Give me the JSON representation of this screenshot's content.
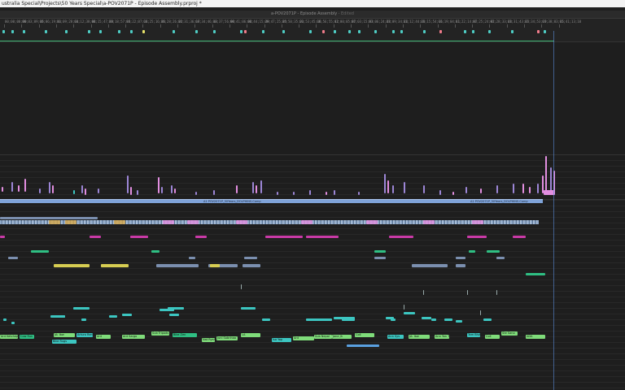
{
  "window": {
    "title": "ustralia Special\\Projects\\50 Years Special\\a-POV2071P - Episode Assembly.prproj *"
  },
  "panel": {
    "tab_label": "a-POV2071P - Episode Assembly",
    "tab_separator": "·",
    "tab_status": "Edited"
  },
  "ruler": {
    "timecodes": [
      "00;00;00;00",
      "00;03;09;15",
      "00;06;19;11",
      "00;09;28;11",
      "00;12;38;04",
      "00;15;47;20",
      "00;18;57;15",
      "00;22;07;11",
      "00;25;16;26",
      "00;28;26;22",
      "00;31;36;17",
      "00;34;46;13",
      "00;37;56;08",
      "00;41;06;04",
      "00;44;15;29",
      "00;47;25;25",
      "00;50;35;21",
      "00;53;45;16",
      "00;56;55;12",
      "01;00;05;07",
      "01;03;15;03",
      "01;06;24;28",
      "01;09;34;24",
      "01;12;44;20",
      "01;15;54;16",
      "01;19;04;11",
      "01;22;14;07",
      "01;25;24;02",
      "01;28;33;28",
      "01;31;43;23",
      "01;34;53;19",
      "01;38;03;15",
      "01;41;13;10"
    ],
    "marker_colors": [
      "#4ecdc4",
      "#4ecdc4",
      "#4ecdc4",
      "#4ecdc4",
      "#4ecdc4",
      "#4ecdc4",
      "#4ecdc4",
      "#4ecdc4",
      "#4ecdc4",
      "#e8e36a",
      "#4ecdc4",
      "#4ecdc4",
      "#4ecdc4",
      "#4ecdc4",
      "#ef7b8a",
      "#4ecdc4",
      "#4ecdc4",
      "#4ecdc4",
      "#ef7b8a",
      "#4ecdc4",
      "#4ecdc4",
      "#4ecdc4",
      "#4ecdc4",
      "#4ecdc4",
      "#4ecdc4",
      "#4ecdc4",
      "#ef7b8a",
      "#4ecdc4",
      "#4ecdc4",
      "#4ecdc4",
      "#4ecdc4",
      "#ef7b8a",
      "#4ecdc4"
    ]
  },
  "timeline": {
    "audio_clip_label_1": "A1  POV2071P_50Years_DOLPHINS-Comp",
    "audio_clip_label_2": "A1  POV2071P_50Years_DOLPHINS-Comp",
    "graphics_clip_labels": [
      "Ant Ketchep",
      "Cow Run",
      "JA: Ibw",
      "Arturo Rennels",
      "Ant",
      "Ant Sargo",
      "Sub Tripods",
      "Bike Zen",
      "Nat Ryan",
      "Juni Sabrinaa",
      "LA",
      "Isa Yap",
      "Ant",
      "Sub Nepal",
      "Jane Jh",
      "Coll",
      "Ann Sys",
      "JA: Ibw",
      "Ann Yan Tan",
      "Tam Bhwa",
      "Coll",
      "Ste Sano",
      "ADA",
      "Bike Rugs"
    ],
    "tint_colors": {
      "video_pink": "#e28ee0",
      "video_purple": "#9c86d6",
      "audio_blue": "#7fa3d9",
      "magenta": "#c93aa7",
      "green": "#2fbf83",
      "yellow": "#d7cd52",
      "teal": "#3cc6c1",
      "lightgreen": "#7fdc7a",
      "slate": "#7b8faf"
    }
  }
}
